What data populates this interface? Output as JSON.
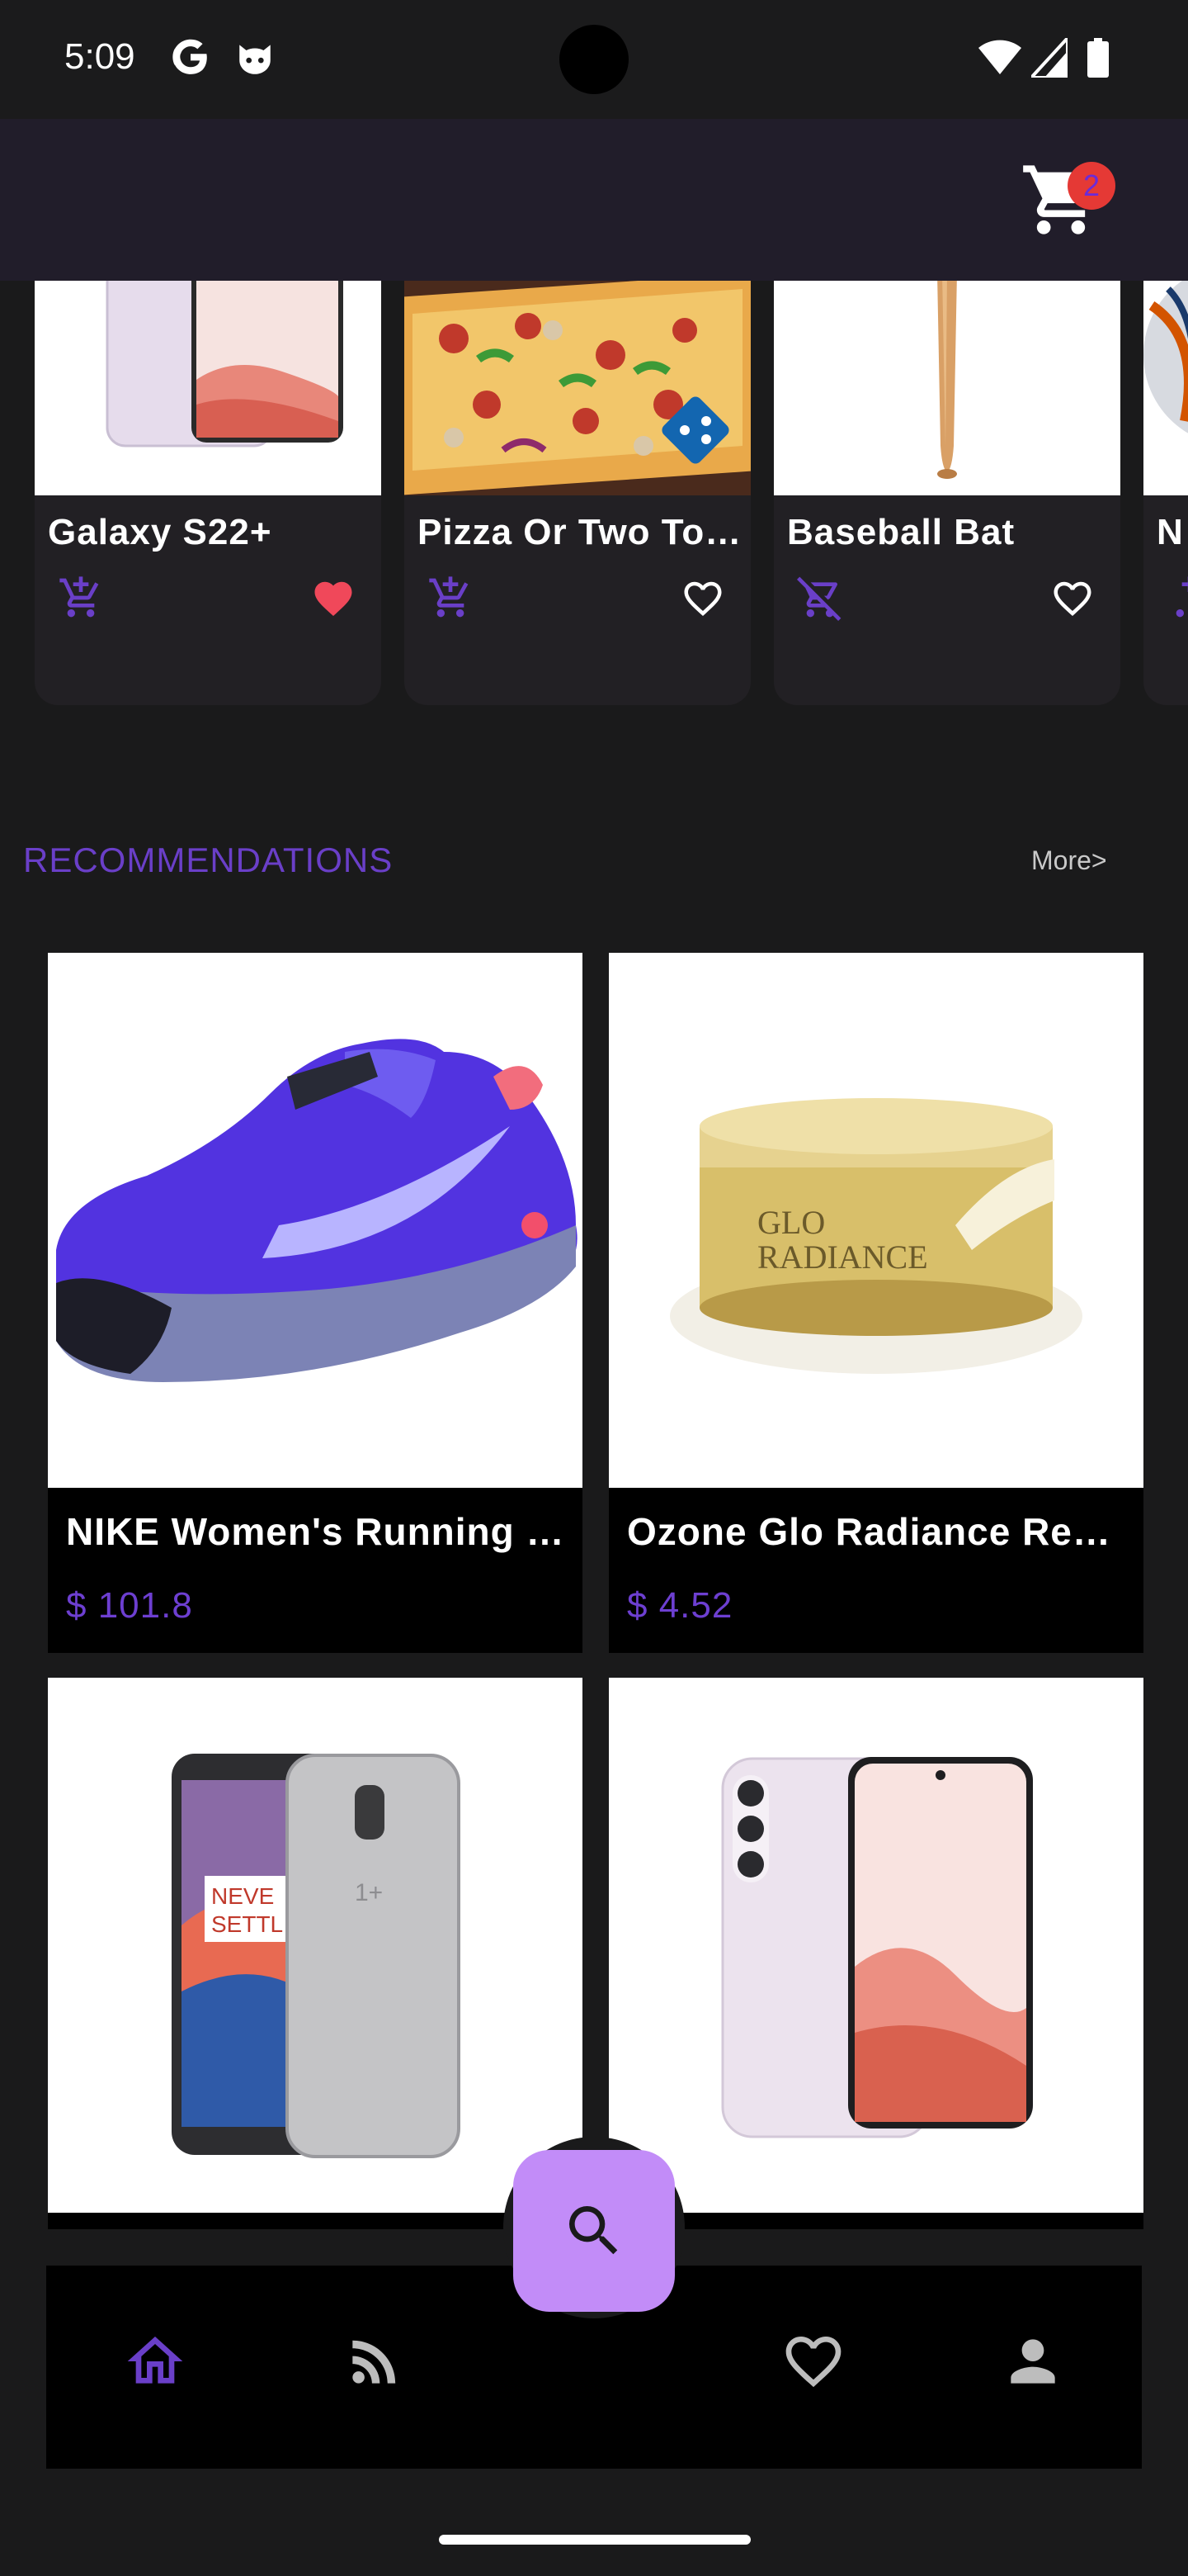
{
  "status_bar": {
    "time": "5:09",
    "icons": [
      "google-icon",
      "cat-icon",
      "wifi-icon",
      "signal-icon",
      "battery-icon"
    ]
  },
  "app_bar": {
    "cart_icon": "cart-icon",
    "cart_count": "2"
  },
  "strip": {
    "items": [
      {
        "title": "Galaxy S22+",
        "cart_icon": "add-to-cart-icon",
        "favorite": true
      },
      {
        "title": "Pizza Or Two Toppings",
        "cart_icon": "add-to-cart-icon",
        "favorite": false
      },
      {
        "title": "Baseball Bat",
        "cart_icon": "remove-from-cart-icon",
        "favorite": false
      },
      {
        "title": "N",
        "cart_icon": "add-to-cart-icon",
        "favorite": false
      }
    ]
  },
  "recommendations": {
    "title": "RECOMMENDATIONS",
    "more": "More>",
    "items": [
      {
        "title": "NIKE Women's Running Shoe",
        "price": "$ 101.8"
      },
      {
        "title": "Ozone Glo Radiance Renewing Day Cream",
        "price": "$ 4.52"
      },
      {
        "title": "",
        "price": ""
      },
      {
        "title": "",
        "price": ""
      }
    ]
  },
  "bottom_nav": {
    "items": [
      "home-icon",
      "feed-icon",
      "favorites-icon",
      "profile-icon"
    ],
    "active": "home-icon",
    "fab_icon": "search-icon"
  },
  "colors": {
    "accent": "#6a3fc8",
    "fab": "#c28cf8",
    "badge": "#e53935",
    "favorite": "#f0485a"
  }
}
